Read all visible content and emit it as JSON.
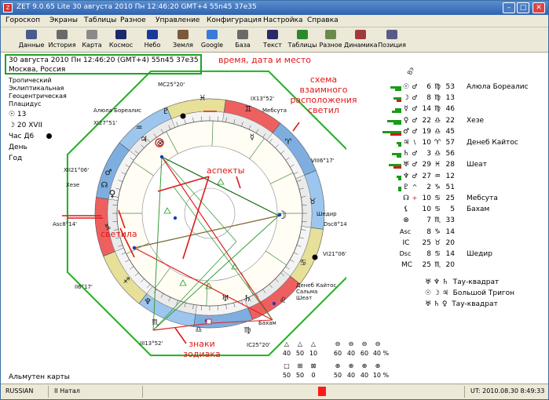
{
  "window": {
    "title": "ZET 9.0.65 Lite   30 августа 2010  Пн  12:46:20 GMT+4 55n45  37e35",
    "btn_min": "–",
    "btn_max": "□",
    "btn_close": "✕"
  },
  "menu": [
    "Гороскоп",
    "Экраны",
    "Таблицы",
    "Разное",
    "Управление",
    "Конфигурация",
    "Настройка",
    "Справка"
  ],
  "toolbar": [
    {
      "label": "Данные",
      "color": "#4a5a8a"
    },
    {
      "label": "История",
      "color": "#6a6a6a"
    },
    {
      "label": "Карта",
      "color": "#8a8a8a"
    },
    {
      "label": "Космос",
      "color": "#1a2a6a"
    },
    {
      "label": "Небо",
      "color": "#1a3a9a"
    },
    {
      "label": "Земля",
      "color": "#7a5a3a"
    },
    {
      "label": "Google",
      "color": "#3a7ad8"
    },
    {
      "label": "База",
      "color": "#6a6a6a"
    },
    {
      "label": "Текст",
      "color": "#2a2a6a"
    },
    {
      "label": "Таблицы",
      "color": "#2a8a2a"
    },
    {
      "label": "Разное",
      "color": "#6a8a4a"
    },
    {
      "label": "Динамика",
      "color": "#a03a3a"
    },
    {
      "label": "Позиция",
      "color": "#5a5a8a"
    }
  ],
  "info": {
    "line1": "30 августа 2010  Пн   12:46:20 (GMT+4)  55n45  37e35",
    "line2": "Москва, Россия"
  },
  "annotations": {
    "time_place": "время, дата и место",
    "scheme": "схема\nвзаимного\nрасположения\nсветил",
    "aspects": "аспекты",
    "luminaries": "светила",
    "zodiac": "знаки\nзодиака"
  },
  "left_info": {
    "lines": [
      "Тропический",
      "Эклиптикальная",
      "Геоцентрическая",
      "Плацидус"
    ],
    "sun_line": "☉  13",
    "moon_line": "☽  20 XVII",
    "hour_line": "Час Д6",
    "day_line": "День",
    "year_line": "Год",
    "almuten": "Альмутен карты"
  },
  "cusps": {
    "MC": "MC25°20'",
    "IX": "IX13°52'",
    "XI": "XI27°51'",
    "XII": "XII21°06'",
    "Asc": "Asc8°14'",
    "II": "II6°17'",
    "III": "III13°52'",
    "IC": "IC25°20'",
    "VI": "VI21°06'",
    "Dsc": "Dsc8°14'",
    "VIII": "VIII6°17'"
  },
  "chart_stars": {
    "alula": "Алюла Бореалис",
    "mebsuta": "Мебсута",
    "kheze": "Хезе",
    "shedir": "Шедир",
    "deneb": "Денеб Кайтос\nСальма\nШеат",
    "baham": "Бахам"
  },
  "planets_header": "Вэ",
  "planets": [
    {
      "sym": "☉",
      "asp": "♂",
      "deg": "6",
      "sign": "♍",
      "min": "53",
      "star": "Алюла Бореалис",
      "b1": 14,
      "b2": 8
    },
    {
      "sym": "☽",
      "asp": "♂",
      "deg": "8",
      "sign": "♍",
      "min": "13",
      "star": "",
      "b1": 10,
      "b2": 6
    },
    {
      "sym": "☿",
      "asp": "♂",
      "deg": "14",
      "sign": "♍",
      "min": "46",
      "star": "",
      "b1": 8,
      "b2": 12
    },
    {
      "sym": "♀",
      "asp": "♂",
      "deg": "22",
      "sign": "♎",
      "min": "22",
      "star": "Хезе",
      "b1": 18,
      "b2": 10
    },
    {
      "sym": "♂",
      "asp": "♂",
      "deg": "19",
      "sign": "♎",
      "min": "45",
      "star": "",
      "b1": 24,
      "b2": 14
    },
    {
      "sym": "♃",
      "asp": "\\",
      "deg": "10",
      "sign": "♈",
      "min": "57",
      "star": "Денеб Кайтос",
      "b1": 6,
      "b2": 4
    },
    {
      "sym": "♄",
      "asp": "♂",
      "deg": "3",
      "sign": "♎",
      "min": "56",
      "star": "",
      "b1": 12,
      "b2": 6
    },
    {
      "sym": "♅",
      "asp": "♂",
      "deg": "29",
      "sign": "♓",
      "min": "28",
      "star": "Шеат",
      "b1": 16,
      "b2": 10
    },
    {
      "sym": "♆",
      "asp": "♂",
      "deg": "27",
      "sign": "♒",
      "min": "12",
      "star": "",
      "b1": 6,
      "b2": 4
    },
    {
      "sym": "♇",
      "asp": "^",
      "deg": "2",
      "sign": "♑",
      "min": "51",
      "star": "",
      "b1": 4,
      "b2": 4
    },
    {
      "sym": "☊",
      "asp": "+",
      "deg": "10",
      "sign": "♋",
      "min": "25",
      "star": "Мебсута",
      "b1": 0,
      "b2": 0
    },
    {
      "sym": "⚸",
      "asp": "",
      "deg": "10",
      "sign": "♋",
      "min": "5",
      "star": "Бахам",
      "b1": 0,
      "b2": 0
    },
    {
      "sym": "⊗",
      "asp": "",
      "deg": "7",
      "sign": "♏",
      "min": "33",
      "star": "",
      "b1": 0,
      "b2": 0
    },
    {
      "sym": "Asc",
      "asp": "",
      "deg": "8",
      "sign": "♑",
      "min": "14",
      "star": "",
      "b1": 0,
      "b2": 0
    },
    {
      "sym": "IC",
      "asp": "",
      "deg": "25",
      "sign": "♉",
      "min": "20",
      "star": "",
      "b1": 0,
      "b2": 0
    },
    {
      "sym": "Dsc",
      "asp": "",
      "deg": "8",
      "sign": "♋",
      "min": "14",
      "star": "Шедир",
      "b1": 0,
      "b2": 0
    },
    {
      "sym": "MC",
      "asp": "",
      "deg": "25",
      "sign": "♏",
      "min": "20",
      "star": "",
      "b1": 0,
      "b2": 0
    }
  ],
  "figures": [
    {
      "syms": "♅ ♆ ♄",
      "label": "Тау-квадрат"
    },
    {
      "syms": "☉ ☽ ♃",
      "label": "Большой Тригон"
    },
    {
      "syms": "♅ ♄ ♀",
      "label": "Тау-квадрат"
    }
  ],
  "legend": {
    "row1_syms": [
      "△",
      "△",
      "△",
      "⊖",
      "⊖",
      "⊖",
      "⊖"
    ],
    "row1_vals": [
      "40",
      "50",
      "10",
      "60",
      "40",
      "60",
      "40 %"
    ],
    "row2_syms": [
      "□",
      "⊞",
      "⊠",
      "⊕",
      "⊕",
      "⊕",
      "⊕"
    ],
    "row2_vals": [
      "50",
      "50",
      "0",
      "50",
      "40",
      "40",
      "10 %"
    ]
  },
  "status": {
    "lang": "RUSSIAN",
    "chart": "II Натал",
    "indicator_color": "#ff1a1a",
    "time": "UT: 2010.08.30     8:49:33"
  }
}
